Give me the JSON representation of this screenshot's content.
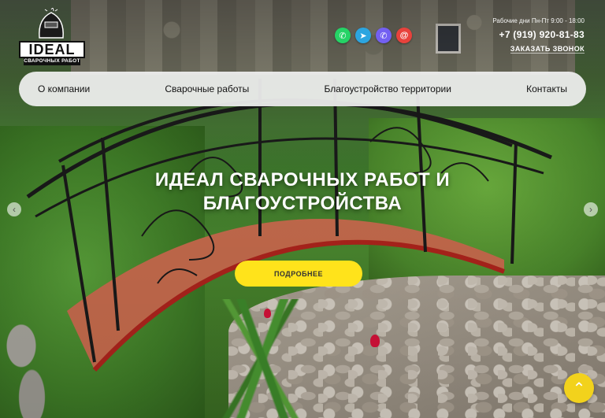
{
  "logo": {
    "title": "IDEAL",
    "subtitle": "СВАРОЧНЫХ РАБОТ"
  },
  "socials": [
    {
      "name": "whatsapp",
      "icon": "whatsapp-icon",
      "color": "#25d366",
      "glyph": "✆"
    },
    {
      "name": "telegram",
      "icon": "telegram-icon",
      "color": "#2ca5e0",
      "glyph": "➤"
    },
    {
      "name": "viber",
      "icon": "viber-icon",
      "color": "#7360f2",
      "glyph": "✆"
    },
    {
      "name": "email",
      "icon": "email-icon",
      "color": "#e8423c",
      "glyph": "@"
    }
  ],
  "contacts": {
    "hours": "Рабочие дни Пн-Пт 9:00 - 18:00",
    "phone": "+7 (919) 920-81-83",
    "callback": "ЗАКАЗАТЬ ЗВОНОК"
  },
  "nav": {
    "items": [
      "О компании",
      "Сварочные работы",
      "Благоустройство территории",
      "Контакты"
    ]
  },
  "hero": {
    "headline_line1": "ИДЕАЛ СВАРОЧНЫХ РАБОТ И",
    "headline_line2": "БЛАГОУСТРОЙСТВА",
    "cta": "ПОДРОБНЕЕ"
  },
  "slider": {
    "prev_icon": "chevron-left-icon",
    "next_icon": "chevron-right-icon",
    "prev_glyph": "‹",
    "next_glyph": "›"
  },
  "to_top": {
    "icon": "chevron-up-icon",
    "glyph": "⌃",
    "color": "#f2d21c"
  },
  "accent_color": "#ffe31b"
}
